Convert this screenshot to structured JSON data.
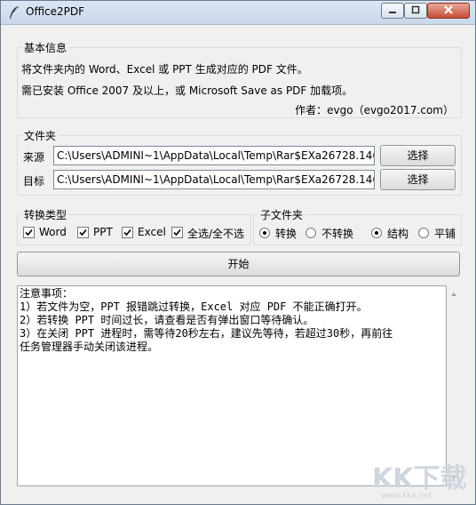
{
  "window": {
    "title": "Office2PDF"
  },
  "info_group": {
    "legend": "基本信息",
    "line1": "将文件夹内的 Word、Excel 或 PPT 生成对应的 PDF 文件。",
    "line2": "需已安装 Office 2007 及以上，或 Microsoft Save as PDF 加载项。",
    "author": "作者：evgo（evgo2017.com）"
  },
  "folder_group": {
    "legend": "文件夹",
    "source_label": "来源",
    "source_value": "C:\\Users\\ADMINI~1\\AppData\\Local\\Temp\\Rar$EXa26728.146",
    "source_button": "选择",
    "target_label": "目标",
    "target_value": "C:\\Users\\ADMINI~1\\AppData\\Local\\Temp\\Rar$EXa26728.146",
    "target_button": "选择"
  },
  "convert_group": {
    "legend": "转换类型",
    "options": [
      {
        "label": "Word",
        "checked": true
      },
      {
        "label": "PPT",
        "checked": true
      },
      {
        "label": "Excel",
        "checked": true
      },
      {
        "label": "全选/全不选",
        "checked": true
      }
    ]
  },
  "subfolder_group": {
    "legend": "子文件夹",
    "options": [
      {
        "label": "转换",
        "selected": true
      },
      {
        "label": "不转换",
        "selected": false
      },
      {
        "label": "结构",
        "selected": true
      },
      {
        "label": "平铺",
        "selected": false
      }
    ]
  },
  "start_button": "开始",
  "notes": [
    "注意事项：",
    "1）若文件为空，PPT 报错跳过转换，Excel 对应 PDF 不能正确打开。",
    "2）若转换 PPT 时间过长，请查看是否有弹出窗口等待确认。",
    "3）在关闭 PPT 进程时，需等待20秒左右，建议先等待，若超过30秒，再前往",
    "任务管理器手动关闭该进程。"
  ],
  "watermark": {
    "logo": "KK下载",
    "url": "www.kkx.net"
  }
}
